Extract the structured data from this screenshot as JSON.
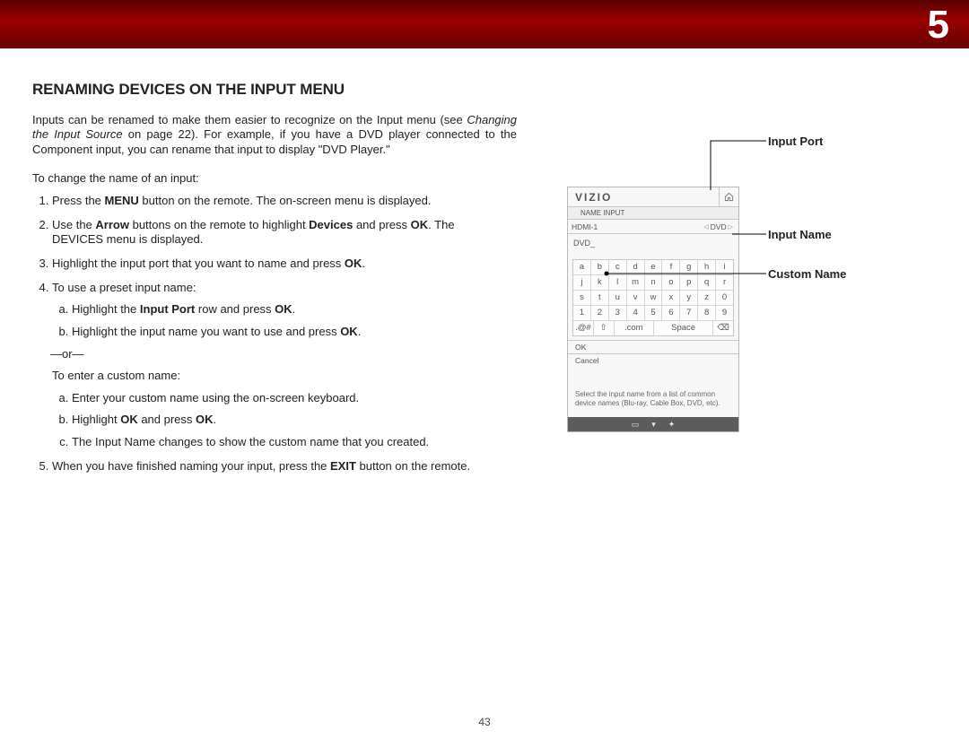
{
  "chapter_number": "5",
  "section_title": "RENAMING DEVICES ON THE INPUT MENU",
  "intro_pre": "Inputs can be renamed to make them easier to recognize on the Input menu (see ",
  "intro_em": "Changing the Input Source",
  "intro_post": " on page 22). For example, if you have a DVD player connected to the Component input, you can rename that input to display \"DVD Player.\"",
  "lead": "To change the name of an input:",
  "steps": {
    "s1_pre": "Press the ",
    "s1_b1": "MENU",
    "s1_post": " button on the remote. The on-screen menu is displayed.",
    "s2_pre": "Use the ",
    "s2_b1": "Arrow",
    "s2_mid": " buttons on the remote to highlight ",
    "s2_b2": "Devices",
    "s2_mid2": " and press ",
    "s2_b3": "OK",
    "s2_post": ". The DEVICES menu is displayed.",
    "s3_pre": "Highlight the input port that you want to name and press ",
    "s3_b1": "OK",
    "s3_post": ".",
    "s4": "To use a preset input name:",
    "s4a_pre": "Highlight the ",
    "s4a_b1": "Input Port",
    "s4a_mid": " row and press ",
    "s4a_b2": "OK",
    "s4a_post": ".",
    "s4b_pre": "Highlight the input name you want to use and press ",
    "s4b_b1": "OK",
    "s4b_post": ".",
    "or": "—or—",
    "customlead": "To enter a custom name:",
    "ca": "Enter your custom name using the on-screen keyboard.",
    "cb_pre": "Highlight ",
    "cb_b1": "OK",
    "cb_mid": " and press ",
    "cb_b2": "OK",
    "cb_post": ".",
    "cc": "The Input Name changes to show the custom name that you created.",
    "s5_pre": "When you have finished naming your input, press the ",
    "s5_b1": "EXIT",
    "s5_post": " button on the remote."
  },
  "callouts": {
    "input_port": "Input Port",
    "input_name": "Input Name",
    "custom_name": "Custom Name"
  },
  "device": {
    "brand": "VIZIO",
    "crumb": "NAME INPUT",
    "port_label": "HDMI-1",
    "port_value": "DVD",
    "custom_value": "DVD_",
    "keys_r1": [
      "a",
      "b",
      "c",
      "d",
      "e",
      "f",
      "g",
      "h",
      "i"
    ],
    "keys_r2": [
      "j",
      "k",
      "l",
      "m",
      "n",
      "o",
      "p",
      "q",
      "r"
    ],
    "keys_r3": [
      "s",
      "t",
      "u",
      "v",
      "w",
      "x",
      "y",
      "z",
      "0"
    ],
    "keys_r4": [
      "1",
      "2",
      "3",
      "4",
      "5",
      "6",
      "7",
      "8",
      "9"
    ],
    "keys_r5_a": ".@#",
    "keys_r5_b": "⇧",
    "keys_r5_c": ".com",
    "keys_r5_d": "Space",
    "keys_r5_e": "⌫",
    "ok": "OK",
    "cancel": "Cancel",
    "help": "Select the input name from a list of common device names (Blu-ray, Cable Box, DVD, etc).",
    "foot_a": "▭",
    "foot_b": "▾",
    "foot_c": "✦"
  },
  "page_number": "43"
}
